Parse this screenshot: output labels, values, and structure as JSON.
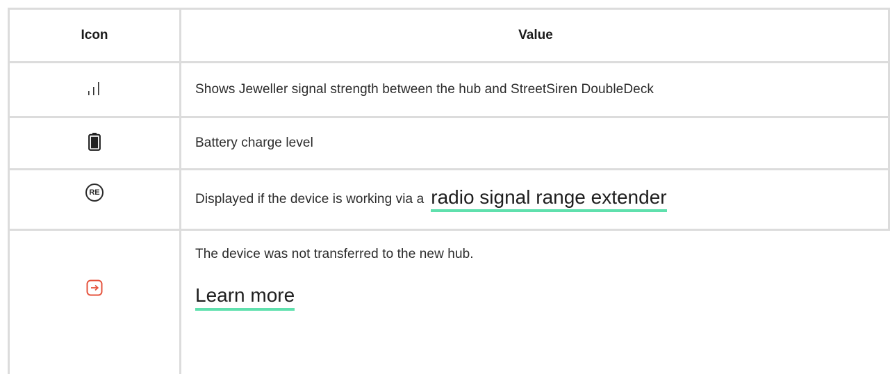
{
  "table": {
    "headers": {
      "icon": "Icon",
      "value": "Value"
    },
    "rows": [
      {
        "icon_name": "signal-strength-icon",
        "value": "Shows Jeweller signal strength between the hub and StreetSiren DoubleDeck"
      },
      {
        "icon_name": "battery-icon",
        "value": "Battery charge level"
      },
      {
        "icon_name": "range-extender-re-icon",
        "icon_text": "RE",
        "value": "Displayed if the device is working via a",
        "link": "radio signal range extender"
      },
      {
        "icon_name": "device-not-transferred-icon",
        "icon_color": "#e5533d",
        "value": "The device was not transferred to the new hub.",
        "link": "Learn more"
      }
    ]
  },
  "colors": {
    "border": "#dcdcdc",
    "link_underline": "#5fe0ad",
    "warning": "#e5533d"
  }
}
